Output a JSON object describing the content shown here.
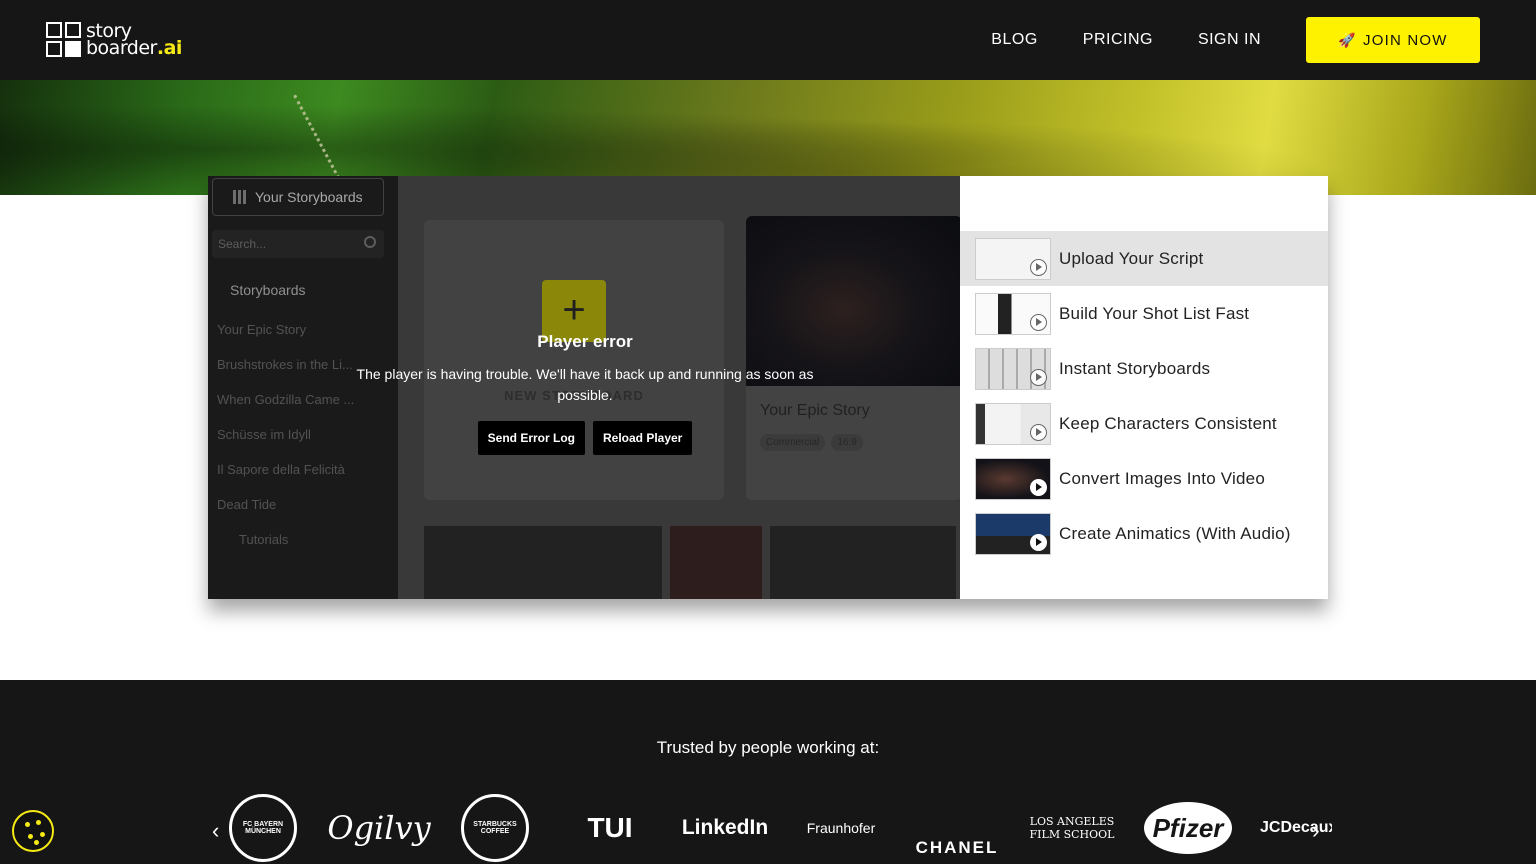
{
  "nav": {
    "logo_line1": "story",
    "logo_line2": "boarder",
    "logo_ai": ".ai",
    "links": [
      "BLOG",
      "PRICING",
      "SIGN IN"
    ],
    "cta": "JOIN NOW",
    "cta_icon": "rocket-icon"
  },
  "app": {
    "sidebar_button": "Your Storyboards",
    "search_placeholder": "Search...",
    "section": "Storyboards",
    "items": [
      "Your Epic Story",
      "Brushstrokes in the Li...",
      "When Godzilla Came ...",
      "Schüsse im Idyll",
      "Il Sapore della Felicità",
      "Dead Tide"
    ],
    "tutorials": "Tutorials",
    "new_label": "NEW STORYBOARD",
    "card_title": "Your Epic Story",
    "tag1": "Commercial",
    "tag2": "16:9"
  },
  "error": {
    "title": "Player error",
    "message": "The player is having trouble. We'll have it back up and running as soon as possible.",
    "send_log": "Send Error Log",
    "reload": "Reload Player"
  },
  "playlist": [
    {
      "label": "Upload Your Script",
      "active": true
    },
    {
      "label": "Build Your Shot List Fast",
      "active": false
    },
    {
      "label": "Instant Storyboards",
      "active": false
    },
    {
      "label": "Keep Characters Consistent",
      "active": false
    },
    {
      "label": "Convert Images Into Video",
      "active": false
    },
    {
      "label": "Create Animatics (With Audio)",
      "active": false
    }
  ],
  "trusted": {
    "title": "Trusted by people working at:",
    "logos": [
      "FC BAYERN MÜNCHEN",
      "Ogilvy",
      "STARBUCKS COFFEE",
      "TUI",
      "LinkedIn",
      "Fraunhofer",
      "CHANEL",
      "LOS ANGELES FILM SCHOOL",
      "Pfizer",
      "JCDecaux"
    ]
  },
  "colors": {
    "accent": "#fff200",
    "dark": "#161616"
  }
}
